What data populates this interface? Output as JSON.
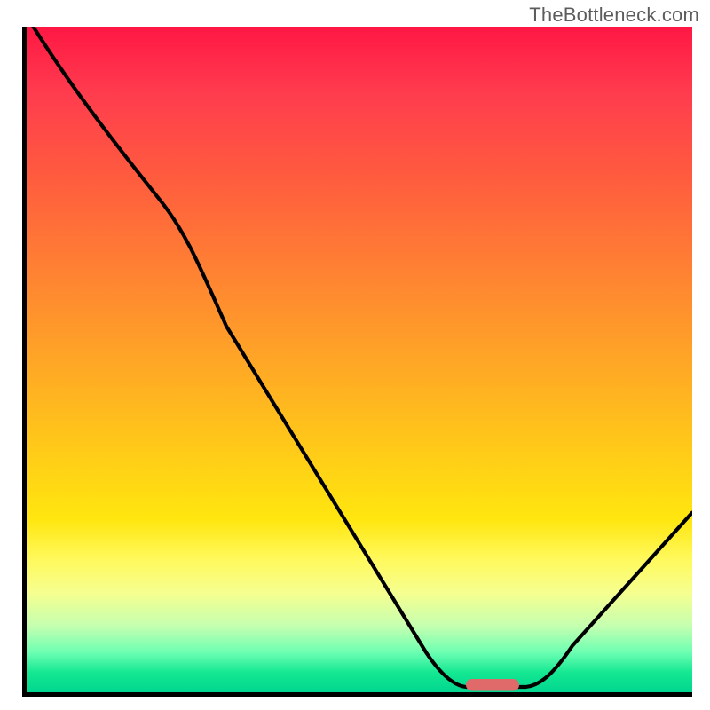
{
  "watermark": "TheBottleneck.com",
  "chart_data": {
    "type": "line",
    "title": "",
    "xlabel": "",
    "ylabel": "",
    "xlim": [
      0,
      100
    ],
    "ylim": [
      0,
      100
    ],
    "grid": false,
    "background": "gradient-red-to-green-vertical",
    "series": [
      {
        "name": "bottleneck-curve",
        "x": [
          1,
          10,
          20,
          30,
          40,
          50,
          60,
          66,
          70,
          75,
          80,
          90,
          100
        ],
        "y": [
          100,
          87,
          74,
          55,
          37,
          21,
          6,
          0,
          0,
          0,
          5,
          15,
          27
        ],
        "note": "y is approximate percentage (0 = bottom/green, 100 = top/red); curve has a broad minimum near x≈66-75"
      }
    ],
    "marker": {
      "name": "optimum-point",
      "x_range": [
        66,
        74
      ],
      "y": 0,
      "color": "#e06a6a",
      "shape": "rounded-bar"
    }
  }
}
